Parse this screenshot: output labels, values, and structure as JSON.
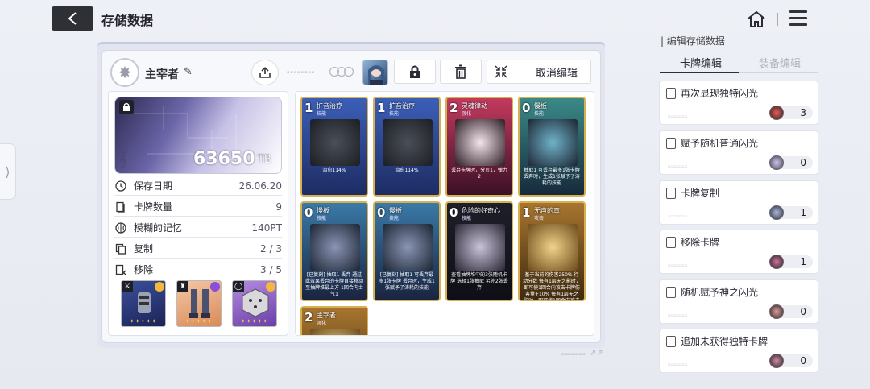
{
  "header": {
    "title": "存储数据"
  },
  "toolbar": {
    "owner_name": "主宰者",
    "cancel_edit": "取消编辑"
  },
  "banner": {
    "amount": "63650",
    "unit": "TB"
  },
  "info": [
    {
      "label": "保存日期",
      "value": "26.06.20"
    },
    {
      "label": "卡牌数量",
      "value": "9"
    },
    {
      "label": "模糊的记忆",
      "value": "140PT"
    },
    {
      "label": "复制",
      "value": "2 / 3"
    },
    {
      "label": "移除",
      "value": "3 / 5"
    }
  ],
  "cards": [
    {
      "cost": "1",
      "name": "扩音治疗",
      "type": "技能",
      "desc": "治愈114%"
    },
    {
      "cost": "1",
      "name": "扩音治疗",
      "type": "技能",
      "desc": "治愈114%"
    },
    {
      "cost": "2",
      "name": "灵魂律动",
      "type": "强化",
      "desc": "丢弃卡牌时，分贝1，弹力2"
    },
    {
      "cost": "0",
      "name": "慢板",
      "type": "技能",
      "desc": "抽取1 可丢弃最多1张卡牌 丢弃时，生成1张赋予了涛耗的技能"
    },
    {
      "cost": "0",
      "name": "慢板",
      "type": "技能",
      "desc": "[已复刻] 抽取1 丢弃 通过此效果丢弃的卡牌直接移动至抽牌堆最上方 1回合内士气1"
    },
    {
      "cost": "0",
      "name": "慢板",
      "type": "技能",
      "desc": "[已复刻] 抽取1 可丢弃最多1张卡牌 丢弃时，生成1张赋予了涛耗的技能"
    },
    {
      "cost": "0",
      "name": "危险的好奇心",
      "type": "技能",
      "desc": "查看抽牌堆中的3张随机卡牌 选择1张抽取 另外2张丢弃"
    },
    {
      "cost": "1",
      "name": "无声的真",
      "type": "攻击",
      "desc": "基于当前的伤害250% 行动分数 每有1层无之影时，即可使1回合内攻击卡牌伤害量+10% 每有1层无之影时，即可使1回合内攻击卡牌伤害量+10%"
    },
    {
      "cost": "2",
      "name": "主宰者",
      "type": "强化",
      "desc": ""
    }
  ],
  "right": {
    "header": "编辑存储数据",
    "tab_cards": "卡牌编辑",
    "tab_equip": "装备编辑",
    "abilities": [
      {
        "label": "再次显现独特闪光",
        "count": "3"
      },
      {
        "label": "赋予随机普通闪光",
        "count": "0"
      },
      {
        "label": "卡牌复制",
        "count": "1"
      },
      {
        "label": "移除卡牌",
        "count": "1"
      },
      {
        "label": "随机赋予神之闪光",
        "count": "0"
      },
      {
        "label": "追加未获得独特卡牌",
        "count": "0"
      }
    ]
  },
  "colors": {
    "accent": "#2f3035",
    "gold": "#d9b04f",
    "banner_purple": "#6b66a8"
  }
}
